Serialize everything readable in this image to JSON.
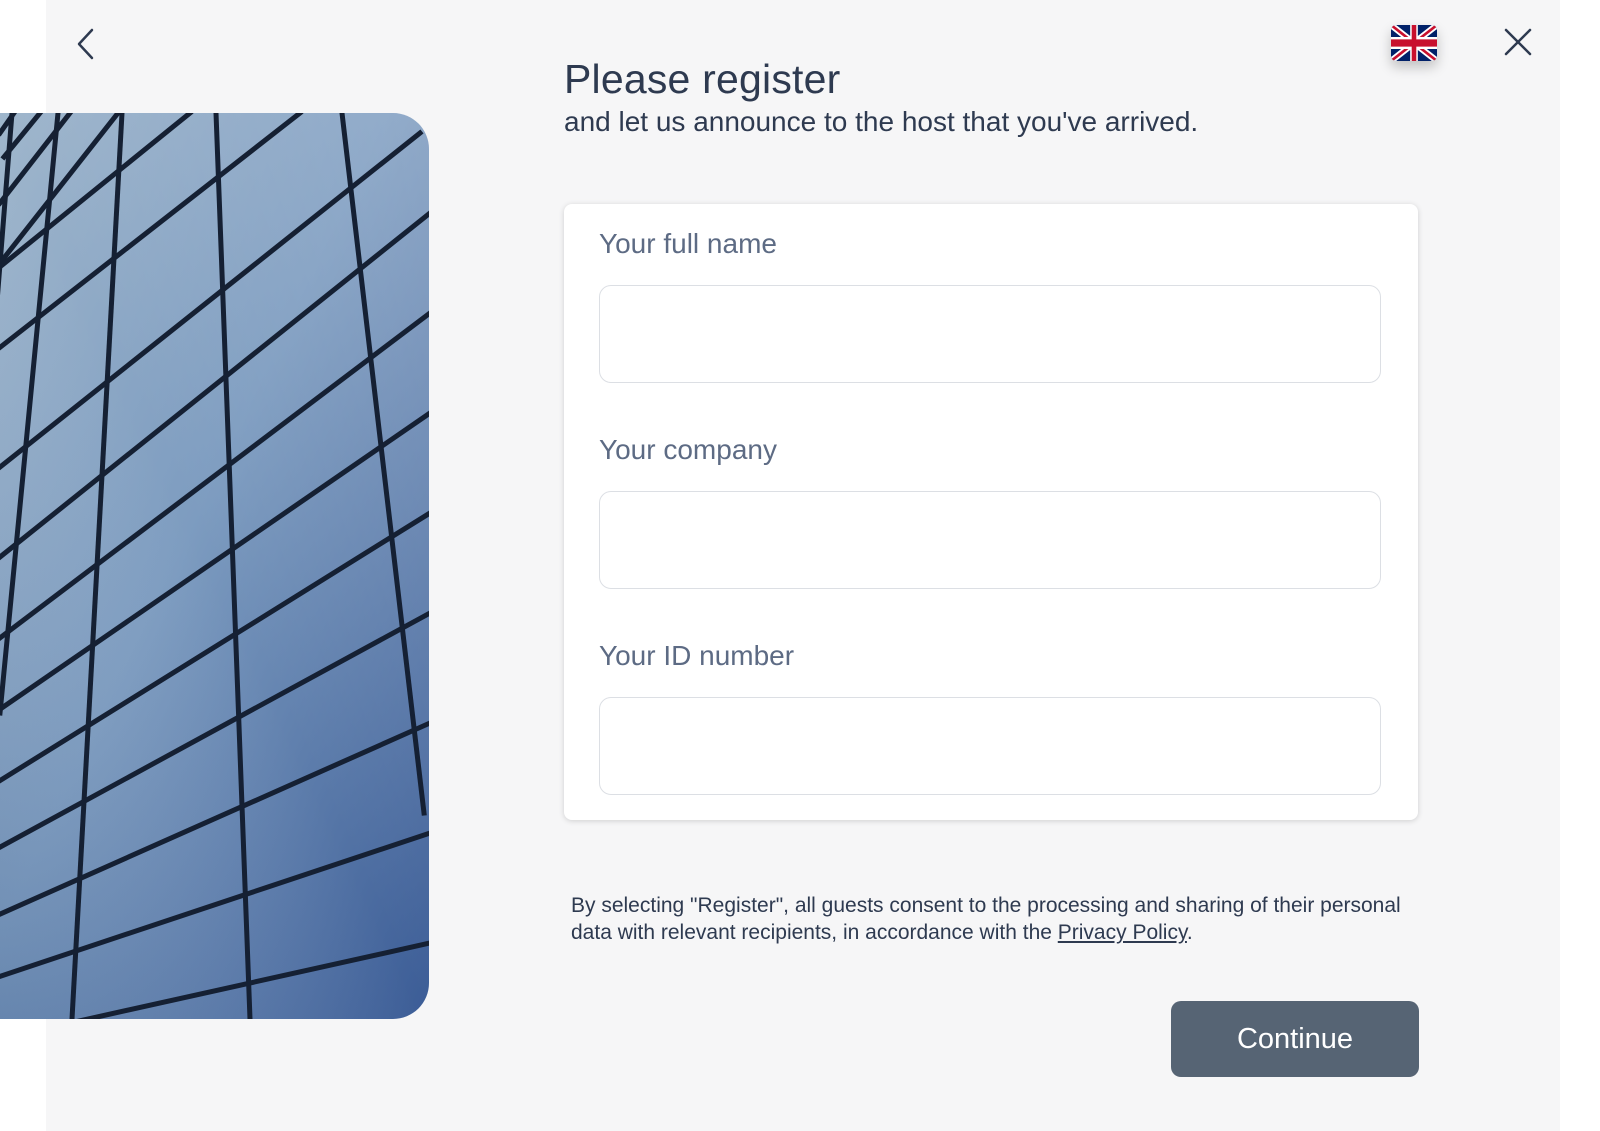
{
  "header": {
    "back_icon": "chevron-left-icon",
    "close_icon": "close-icon",
    "language_flag": "uk-flag-icon"
  },
  "page": {
    "title": "Please register",
    "subtitle": "and let us announce to the host that you've arrived."
  },
  "form": {
    "fields": [
      {
        "label": "Your full name",
        "value": ""
      },
      {
        "label": "Your company",
        "value": ""
      },
      {
        "label": "Your ID number",
        "value": ""
      }
    ]
  },
  "consent": {
    "text": "By selecting \"Register\", all guests consent to the processing and sharing of their personal data with relevant recipients, in accordance with the ",
    "link_label": "Privacy Policy",
    "suffix": "."
  },
  "actions": {
    "continue_label": "Continue"
  },
  "colors": {
    "background": "#f6f6f7",
    "text": "#2e3a50",
    "label": "#5d6b84",
    "button": "#566474",
    "button_text": "#ffffff"
  }
}
